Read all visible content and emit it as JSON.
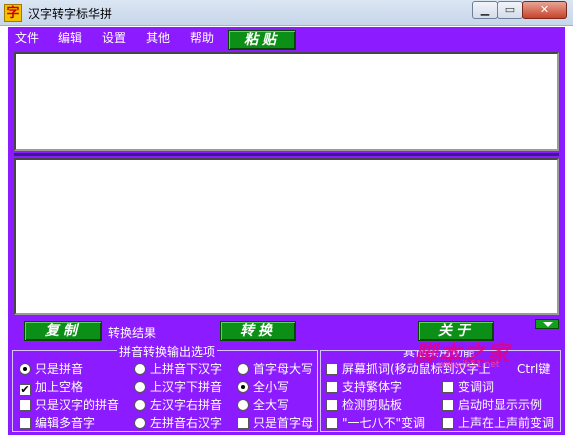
{
  "window": {
    "icon_glyph": "字",
    "title": "汉字转字标华拼",
    "min_glyph": "▁",
    "max_glyph": "▭",
    "close_glyph": "✕"
  },
  "menu": [
    "文件",
    "编辑",
    "设置",
    "其他",
    "帮助"
  ],
  "buttons": {
    "paste_top": "粘贴",
    "copy": "复制",
    "convert": "转换",
    "close": "关于"
  },
  "labels": {
    "result": "转换结果"
  },
  "pinyin_group": {
    "title": "拼音转换输出选项",
    "col1": [
      {
        "label": "只是拼音",
        "type": "radio",
        "checked": true
      },
      {
        "label": "加上空格",
        "type": "check",
        "checked": true
      },
      {
        "label": "只是汉字的拼音",
        "type": "check",
        "checked": false
      },
      {
        "label": "编辑多音字",
        "type": "check",
        "checked": false
      }
    ],
    "col2": [
      {
        "label": "上拼音下汉字",
        "type": "radio",
        "checked": false
      },
      {
        "label": "上汉字下拼音",
        "type": "radio",
        "checked": false
      },
      {
        "label": "左汉字右拼音",
        "type": "radio",
        "checked": false
      },
      {
        "label": "左拼音右汉字",
        "type": "radio",
        "checked": false
      }
    ],
    "col3": [
      {
        "label": "首字母大写",
        "type": "radio",
        "checked": false
      },
      {
        "label": "全小写",
        "type": "radio",
        "checked": true
      },
      {
        "label": "全大写",
        "type": "radio",
        "checked": false
      },
      {
        "label": "只是首字母",
        "type": "check",
        "checked": false
      }
    ]
  },
  "other_group": {
    "title": "其他实用功能",
    "col1": [
      {
        "label": "屏幕抓词(移动鼠标到汉字上",
        "type": "check",
        "checked": false
      },
      {
        "label": "支持繁体字",
        "type": "check",
        "checked": false
      },
      {
        "label": "检测剪贴板",
        "type": "check",
        "checked": false
      },
      {
        "label": "\"一七八不\"变调",
        "type": "check",
        "checked": false
      }
    ],
    "hotkey_text": "Ctrl键",
    "col2": [
      {
        "label": "变调词",
        "type": "check",
        "checked": false
      },
      {
        "label": "启动时显示示例",
        "type": "check",
        "checked": false
      },
      {
        "label": "上声在上声前变调",
        "type": "check",
        "checked": false
      }
    ]
  },
  "watermark": {
    "text": "脚本之家",
    "sub": "www.jb51.net"
  }
}
